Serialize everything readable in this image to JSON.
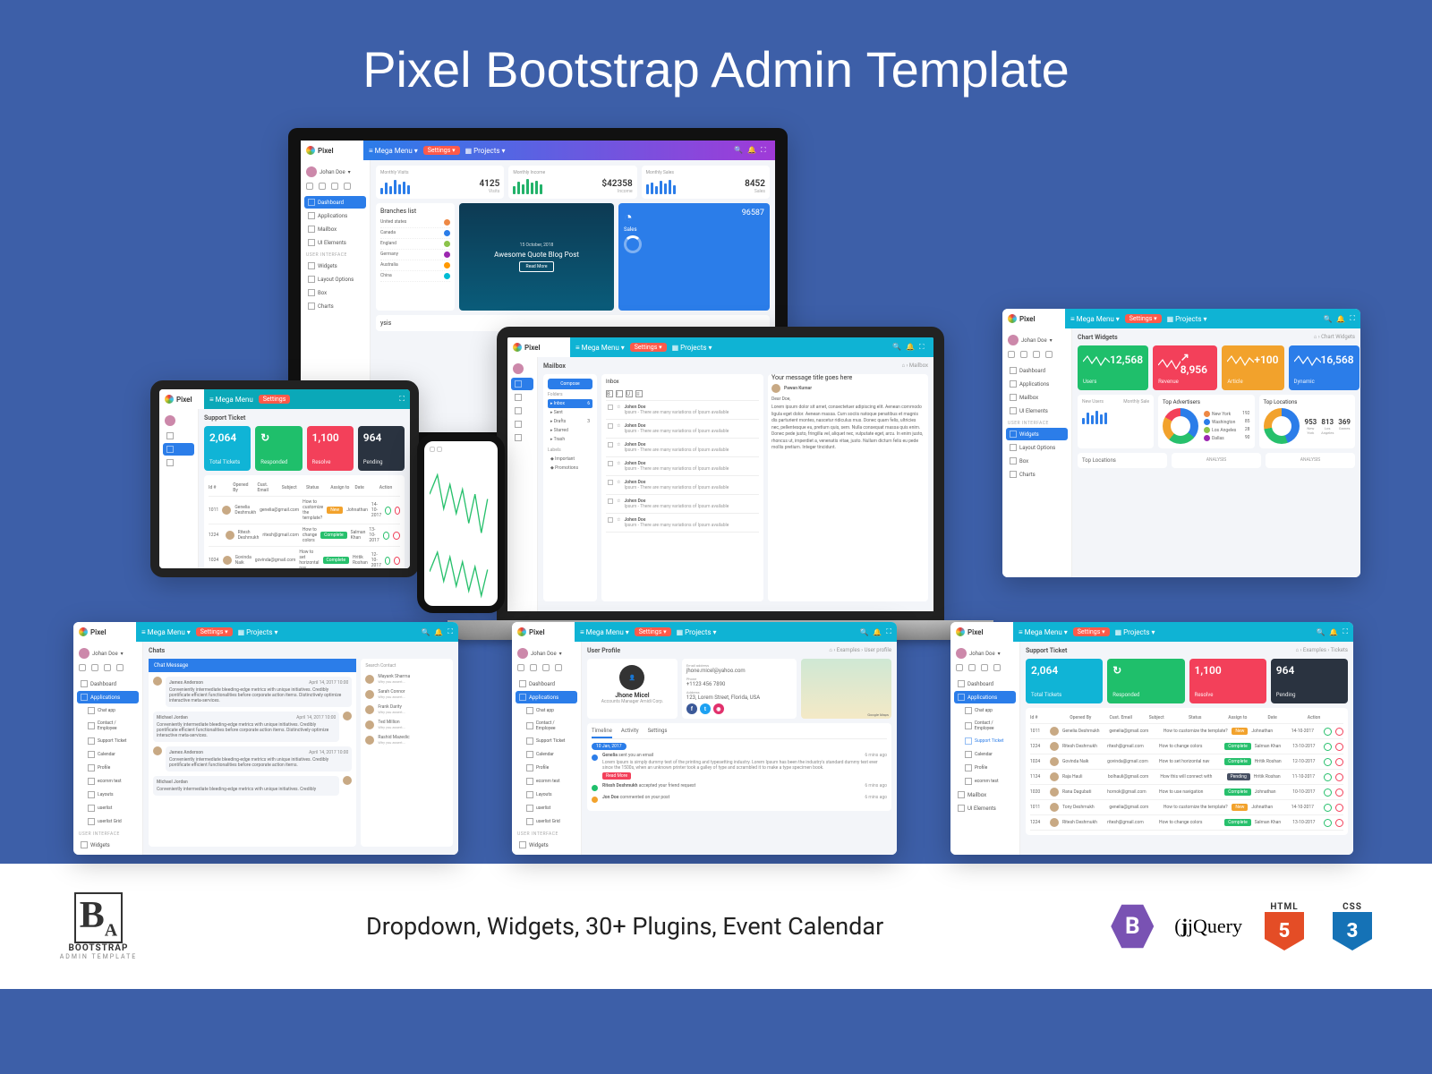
{
  "hero_title": "Pixel Bootstrap Admin Template",
  "footer_tag": "Dropdown, Widgets, 30+ Plugins, Event Calendar",
  "brand": "Pixel",
  "user": "Johan Doe",
  "nav": {
    "mega": "Mega Menu",
    "settings": "Settings",
    "projects": "Projects"
  },
  "sidebar": {
    "groups": [
      {
        "items": [
          "Dashboard",
          "Applications",
          "Mailbox",
          "UI Elements"
        ]
      },
      {
        "head": "USER INTERFACE",
        "items": [
          "Widgets",
          "Layout Options",
          "Box",
          "Charts"
        ]
      }
    ],
    "apps_children": [
      "Chat app",
      "Contact / Employee",
      "Support Ticket",
      "Calendar",
      "Profile",
      "ecomm test",
      "Layouts",
      "userlist",
      "userlist Grid"
    ]
  },
  "dashboard": {
    "stats": [
      {
        "title": "Monthly Visits",
        "value": "4125",
        "sub": "Visits"
      },
      {
        "title": "Monthly Income",
        "value": "$42358",
        "sub": "Income"
      },
      {
        "title": "Monthly Sales",
        "value": "8452",
        "sub": "Sales"
      }
    ],
    "branches": {
      "title": "Branches list",
      "items": [
        "United states",
        "Canada",
        "England",
        "Germany",
        "Australia",
        "China"
      ]
    },
    "blog": {
      "date": "15 October, 2018",
      "title": "Awesome Quote Blog Post",
      "btn": "Read More"
    },
    "sales": {
      "label": "Sales",
      "value": "96587"
    },
    "analysis": "ysis"
  },
  "support": {
    "title": "Support Ticket",
    "crumb": "Examples › Tickets",
    "tiles": [
      {
        "value": "2,064",
        "label": "Total Tickets",
        "color": "bg-cyan"
      },
      {
        "value": "",
        "label": "Responded",
        "color": "bg-green",
        "icon": "↻"
      },
      {
        "value": "1,100",
        "label": "Resolve",
        "color": "bg-red"
      },
      {
        "value": "964",
        "label": "Pending",
        "color": "bg-dark"
      }
    ],
    "cols": [
      "Id #",
      "Opened By",
      "Cust. Email",
      "Subject",
      "Status",
      "Assign to",
      "Date",
      "Action"
    ],
    "rows": [
      {
        "id": "1011",
        "by": "Genelia Deshmukh",
        "email": "genelia@gmail.com",
        "subj": "How to customize the template?",
        "status": "New",
        "st": "bd-amber",
        "assign": "Johnathan",
        "date": "14-10-2017"
      },
      {
        "id": "1224",
        "by": "Ritesh Deshmukh",
        "email": "ritesh@gmail.com",
        "subj": "How to change colors",
        "status": "Complete",
        "st": "bd-green",
        "assign": "Salman Khan",
        "date": "13-10-2017"
      },
      {
        "id": "1024",
        "by": "Govinda Naik",
        "email": "govinda@gmail.com",
        "subj": "How to set horizontal nav",
        "status": "Complete",
        "st": "bd-green",
        "assign": "Hritik Roshan",
        "date": "12-10-2017"
      },
      {
        "id": "1124",
        "by": "Raja Hauli",
        "email": "bolhauli@gmail.com",
        "subj": "How this will connect with",
        "status": "Pending",
        "st": "bd-dark",
        "assign": "Hritik Roshan",
        "date": "11-10-2017"
      },
      {
        "id": "1020",
        "by": "Rana Dagubati",
        "email": "hornok@gmail.com",
        "subj": "How to use navigation",
        "status": "Complete",
        "st": "bd-green",
        "assign": "Johnathan",
        "date": "10-10-2017"
      },
      {
        "id": "1011",
        "by": "Tony Deshmukh",
        "email": "genelia@gmail.com",
        "subj": "How to customize the template?",
        "status": "New",
        "st": "bd-amber",
        "assign": "Johnathan",
        "date": "14-10-2017"
      },
      {
        "id": "1224",
        "by": "Ritesh Deshmukh",
        "email": "ritesh@gmail.com",
        "subj": "How to change colors",
        "status": "Complete",
        "st": "bd-green",
        "assign": "Salman Khan",
        "date": "13-10-2017"
      }
    ]
  },
  "mailbox": {
    "title": "Mailbox",
    "crumb": "Mailbox",
    "compose": "Compose",
    "folders_head": "Folders",
    "folders": [
      {
        "name": "Inbox",
        "n": "6",
        "active": true
      },
      {
        "name": "Sent"
      },
      {
        "name": "Drafts",
        "n": "3"
      },
      {
        "name": "Starred"
      },
      {
        "name": "Trash"
      }
    ],
    "labels_head": "Labels",
    "labels": [
      "Important",
      "Promotions"
    ],
    "list_head": "Inbox",
    "messages": [
      {
        "from": "Johen Doe",
        "line": "Ipsum - There are many variations of Ipsum available"
      },
      {
        "from": "Johen Doe",
        "line": "Ipsum - There are many variations of Ipsum available"
      },
      {
        "from": "Johen Doe",
        "line": "Ipsum - There are many variations of Ipsum available"
      },
      {
        "from": "Johen Doe",
        "line": "Ipsum - There are many variations of Ipsum available"
      },
      {
        "from": "Johen Doe",
        "line": "Ipsum - There are many variations of Ipsum available"
      },
      {
        "from": "Johen Doe",
        "line": "Ipsum - There are many variations of Ipsum available"
      },
      {
        "from": "Johen Doe",
        "line": "Ipsum - There are many variations of Ipsum available"
      }
    ],
    "reader": {
      "subject": "Your message title goes here",
      "from": "Pawan Kumar",
      "greeting": "Dear Doe,",
      "para": "Lorem ipsum dolor sit amet, consectetuer adipiscing elit. Aenean commodo ligula eget dolor. Aenean massa. Cum sociis natoque penatibus et magnis dis parturient montes, nascetur ridiculus mus. Donec quam felis, ultricies nec, pellentesque eu, pretium quis, sem. Nulla consequat massa quis enim. Donec pede justo, fringilla vel, aliquet nec, vulputate eget, arcu. In enim justo, rhoncus ut, imperdiet a, venenatis vitae, justo. Nullam dictum felis eu pede mollis pretium. Integer tincidunt."
    }
  },
  "widgets": {
    "title": "Chart Widgets",
    "crumb": "Chart Widgets",
    "tiles": [
      {
        "value": "12,568",
        "label": "Users",
        "color": "bg-green"
      },
      {
        "value": "8,956",
        "label": "Revenue",
        "color": "bg-red",
        "trend": true
      },
      {
        "value": "+100",
        "label": "Article",
        "color": "bg-amber"
      },
      {
        "value": "16,568",
        "label": "Dynamic",
        "color": "bg-blue"
      }
    ],
    "new_users": "New Users",
    "monthly": "Monthly Sale",
    "top_ad": "Top Advertisers",
    "top_loc": "Top Locations",
    "legend": [
      {
        "name": "New York",
        "v": "192"
      },
      {
        "name": "Washington",
        "v": "85"
      },
      {
        "name": "Los Angeles",
        "v": "28"
      },
      {
        "name": "Dallas",
        "v": "90"
      }
    ],
    "loc_stats": [
      {
        "n": "953",
        "l": "New York"
      },
      {
        "n": "813",
        "l": "Los Angeles"
      },
      {
        "n": "369",
        "l": "Games"
      }
    ],
    "analysis": "ANALYSIS"
  },
  "chats": {
    "title": "Chats",
    "card_title": "Chat Message",
    "search": "Search Contact",
    "msgs": [
      {
        "name": "James Anderson",
        "time": "April 14, 2017 10:00",
        "text": "Conveniently intermediate bleeding-edge metrics with unique initiatives. Credibly pontificate efficient functionalities before corporate action items. Distinctively optimize interactive meta-services."
      },
      {
        "name": "Michael Jordan",
        "time": "April 14, 2017 10:00",
        "text": "Conveniently intermediate bleeding-edge metrics with unique initiatives. Credibly pontificate efficient functionalities before corporate action items. Distinctively optimize interactive meta-services.",
        "right": true
      },
      {
        "name": "James Anderson",
        "time": "April 14, 2017 10:00",
        "text": "Conveniently intermediate bleeding-edge metrics with unique initiatives. Credibly pontificate efficient functionalities before corporate action items."
      },
      {
        "name": "Michael Jordan",
        "time": "",
        "text": "Conveniently intermediate bleeding-edge metrics with unique initiatives. Credibly",
        "right": true
      }
    ],
    "contacts": [
      "Mayank Sharma",
      "Sarah Connor",
      "Frank Darity",
      "Ted Million",
      "Rashid Mazedic"
    ]
  },
  "profile": {
    "title": "User Profile",
    "crumb": "Examples › User profile",
    "name": "Jhone Micel",
    "role": "Accounts Manager Amidi Corp.",
    "email_lbl": "Email address",
    "email": "jhone.micel@yahoo.com",
    "phone_lbl": "Phone",
    "phone": "+1123 456 7890",
    "addr_lbl": "Address",
    "addr": "123, Lorem Street, Florida, USA",
    "tabs": [
      "Timeline",
      "Activity",
      "Settings"
    ],
    "day": "10 Jan, 2017",
    "items": [
      {
        "c": "bg-blue",
        "who": "Genelia",
        "act": "sent you an email",
        "time": "6 mins ago",
        "body": "Lorem Ipsum is simply dummy text of the printing and typesetting industry. Lorem Ipsum has been the industry's standard dummy text ever since the 1500s, when an unknown printer took a galley of type and scrambled it to make a type specimen book.",
        "btn": "Read More"
      },
      {
        "c": "bg-green",
        "who": "Ritesh Deshmukh",
        "act": "accepted your friend request",
        "time": "6 mins ago"
      },
      {
        "c": "bg-amber",
        "who": "Jon Doe",
        "act": "commented on your post",
        "time": "6 mins ago"
      }
    ]
  },
  "ba": {
    "name": "BOOTSTRAP",
    "sub": "ADMIN TEMPLATE"
  },
  "tech": {
    "bootstrap": "B",
    "jquery": "jQuery",
    "html": "HTML",
    "html_n": "5",
    "css": "CSS",
    "css_n": "3"
  }
}
